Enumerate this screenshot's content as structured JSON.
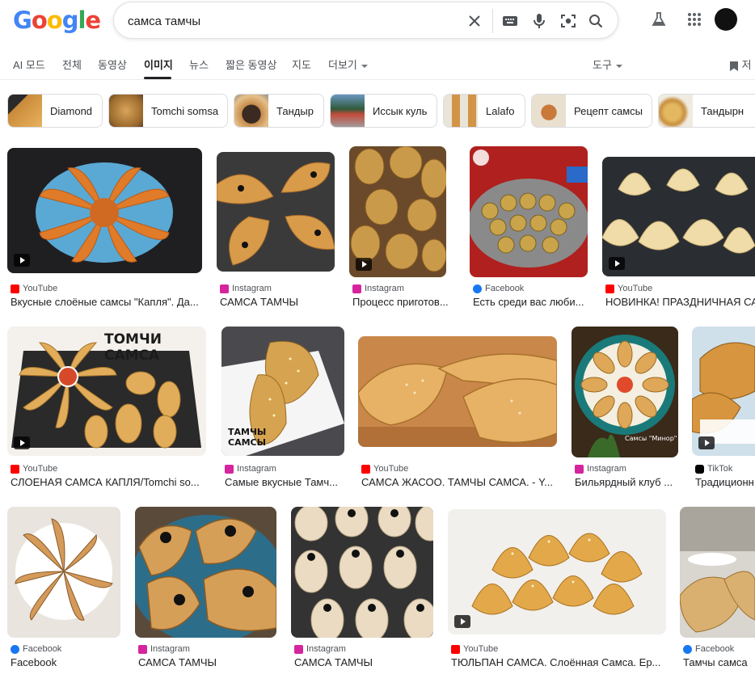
{
  "logo": {
    "text": "Google"
  },
  "search": {
    "query": "самса тамчы"
  },
  "tabs": [
    {
      "label": "AI 모드"
    },
    {
      "label": "전체"
    },
    {
      "label": "동영상"
    },
    {
      "label": "이미지"
    },
    {
      "label": "뉴스"
    },
    {
      "label": "짧은 동영상"
    },
    {
      "label": "지도"
    },
    {
      "label": "더보기"
    },
    {
      "label": "도구"
    },
    {
      "label": "저"
    }
  ],
  "chips": [
    {
      "label": "Diamond"
    },
    {
      "label": "Tomchi somsa"
    },
    {
      "label": "Тандыр"
    },
    {
      "label": "Иссык куль"
    },
    {
      "label": "Lalafo"
    },
    {
      "label": "Рецепт самсы"
    },
    {
      "label": "Тандырн"
    }
  ],
  "results": [
    {
      "source": "YouTube",
      "title": "Вкусные слоёные самсы \"Капля\". Да..."
    },
    {
      "source": "Instagram",
      "title": "САМСА ТАМЧЫ"
    },
    {
      "source": "Instagram",
      "title": "Процесс приготов..."
    },
    {
      "source": "Facebook",
      "title": "Есть среди вас люби..."
    },
    {
      "source": "YouTube",
      "title": "НОВИНКА! ПРАЗДНИЧНАЯ СА"
    },
    {
      "source": "YouTube",
      "title": "СЛОЕНАЯ САМСА КАПЛЯ/Tomchi so...",
      "overlay": "ТОМЧИ САМСА"
    },
    {
      "source": "Instagram",
      "title": "Самые вкусные Тамч...",
      "overlay": "ТАМЧЫ САМСЫ"
    },
    {
      "source": "YouTube",
      "title": "САМСА ЖАСОО. ТАМЧЫ САМСА. - Y..."
    },
    {
      "source": "Instagram",
      "title": "Бильярдный клуб ...",
      "overlay": "Самсы \"Минор\""
    },
    {
      "source": "TikTok",
      "title": "Традиционн"
    },
    {
      "source": "Facebook",
      "title": "Facebook"
    },
    {
      "source": "Instagram",
      "title": "САМСА ТАМЧЫ"
    },
    {
      "source": "Instagram",
      "title": "САМСА ТАМЧЫ"
    },
    {
      "source": "YouTube",
      "title": "ТЮЛЬПАН САМСА. Слоённая Самса. Ер..."
    },
    {
      "source": "Facebook",
      "title": "Тамчы самса"
    }
  ],
  "source_colors": {
    "YouTube": "#ff0000",
    "Instagram": "#d6249f",
    "Facebook": "#1877f2",
    "TikTok": "#010101"
  }
}
